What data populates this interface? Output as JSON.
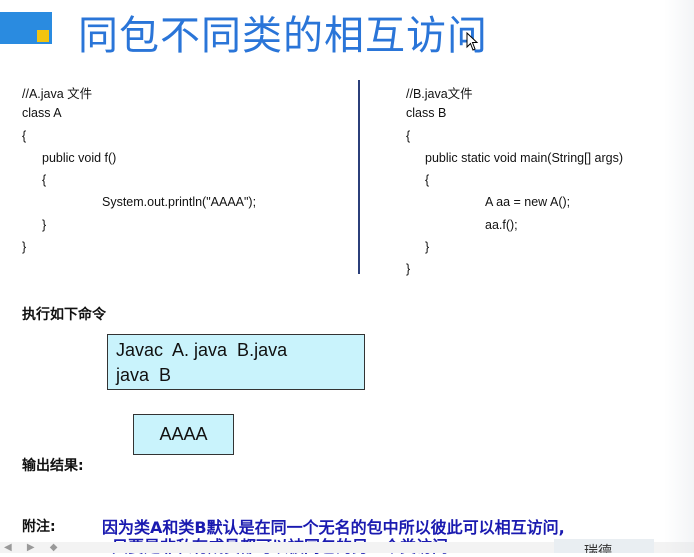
{
  "slide": {
    "title": "同包不同类的相互访问"
  },
  "file_a": {
    "lines": [
      "//A.java 文件",
      "class A",
      "{",
      "public void f()",
      "{",
      "System.out.println(\"AAAA\");",
      "}",
      "}"
    ]
  },
  "file_b": {
    "lines": [
      "//B.java文件",
      "class B",
      "{",
      "public static void main(String[] args)",
      "{",
      "A aa = new A();",
      "aa.f();",
      "}",
      "}"
    ]
  },
  "commands": {
    "label": "执行如下命令",
    "line1": "Javac  A. java  B.java",
    "line2": "java  B"
  },
  "output": {
    "label": "输出结果:",
    "value": "AAAA"
  },
  "note": {
    "label": "附注:",
    "line1": "因为类A和类B默认是在同一个无名的包中所以彼此可以相互访问,",
    "line2": "只要是非私有成员都可以被同包的另一个类访问"
  },
  "watermark": {
    "text": "瑞德"
  },
  "colors": {
    "title": "#2a75d8",
    "box_fill": "#c9f3fc",
    "note_text": "#1a1ab0",
    "logo_blue": "#2a8be0",
    "logo_yellow": "#f2c40f"
  }
}
